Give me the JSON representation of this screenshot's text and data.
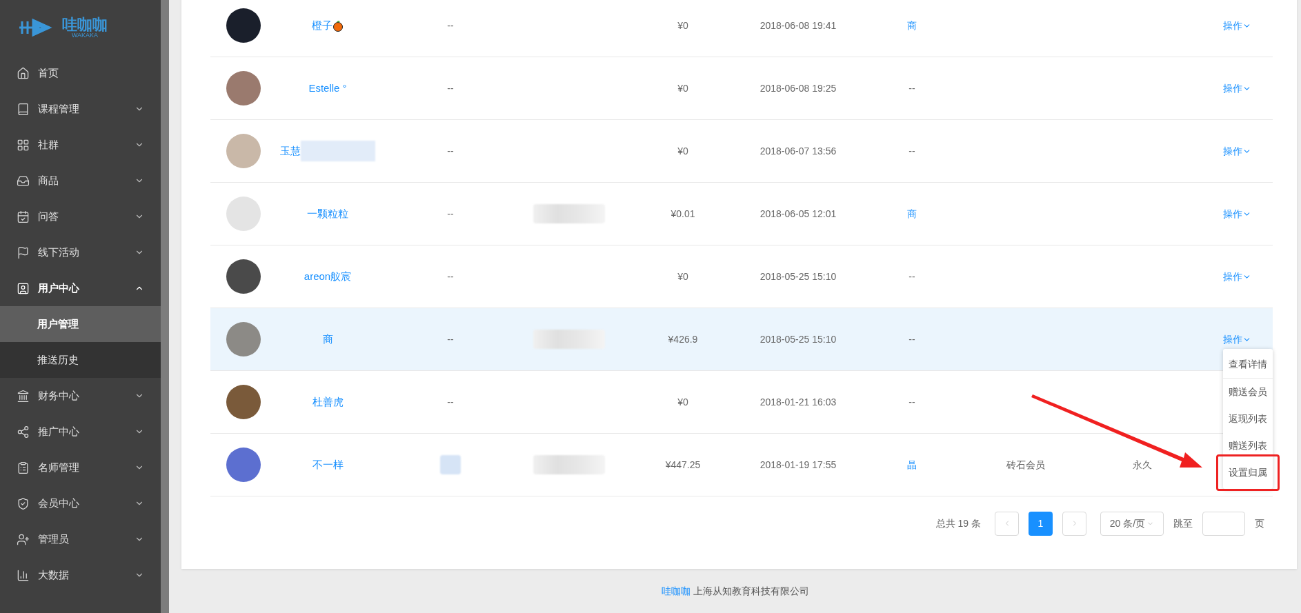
{
  "logo": {
    "text": "哇咖咖",
    "subtext": "WAKAKA"
  },
  "sidebar": {
    "items": [
      {
        "label": "首页",
        "expanded": false,
        "has_children": false
      },
      {
        "label": "课程管理",
        "expanded": false,
        "has_children": true
      },
      {
        "label": "社群",
        "expanded": false,
        "has_children": true
      },
      {
        "label": "商品",
        "expanded": false,
        "has_children": true
      },
      {
        "label": "问答",
        "expanded": false,
        "has_children": true
      },
      {
        "label": "线下活动",
        "expanded": false,
        "has_children": true
      },
      {
        "label": "用户中心",
        "expanded": true,
        "has_children": true,
        "children": [
          {
            "label": "用户管理",
            "selected": true
          },
          {
            "label": "推送历史",
            "selected": false
          }
        ]
      },
      {
        "label": "财务中心",
        "expanded": false,
        "has_children": true
      },
      {
        "label": "推广中心",
        "expanded": false,
        "has_children": true
      },
      {
        "label": "名师管理",
        "expanded": false,
        "has_children": true
      },
      {
        "label": "会员中心",
        "expanded": false,
        "has_children": true
      },
      {
        "label": "管理员",
        "expanded": false,
        "has_children": true
      },
      {
        "label": "大数据",
        "expanded": false,
        "has_children": true
      }
    ]
  },
  "table": {
    "rows": [
      {
        "name": "橙子",
        "has_icon": true,
        "name_blurred": false,
        "column_3": {
          "kind": "text",
          "text": "--"
        },
        "column_4": {
          "kind": "empty"
        },
        "price": "¥0",
        "date": "2018-06-08 19:41",
        "column_7": {
          "kind": "link",
          "text": "商"
        },
        "action": "操作",
        "selected": false
      },
      {
        "name": "Estelle °",
        "has_icon": false,
        "name_blurred": false,
        "column_3": {
          "kind": "text",
          "text": "--"
        },
        "column_4": {
          "kind": "empty"
        },
        "price": "¥0",
        "date": "2018-06-08 19:25",
        "column_7": {
          "kind": "text",
          "text": "--"
        },
        "action": "操作",
        "selected": false
      },
      {
        "name": "玉慧",
        "has_icon": false,
        "name_blurred": true,
        "column_3": {
          "kind": "text",
          "text": "--"
        },
        "column_4": {
          "kind": "empty"
        },
        "price": "¥0",
        "date": "2018-06-07 13:56",
        "column_7": {
          "kind": "text",
          "text": "--"
        },
        "action": "操作",
        "selected": false
      },
      {
        "name": "一颗粒粒",
        "has_icon": false,
        "name_blurred": false,
        "column_3": {
          "kind": "text",
          "text": "--"
        },
        "column_4": {
          "kind": "blurred"
        },
        "price": "¥0.01",
        "date": "2018-06-05 12:01",
        "column_7": {
          "kind": "link",
          "text": "商"
        },
        "action": "操作",
        "selected": false
      },
      {
        "name": "areon舣宸",
        "has_icon": false,
        "name_blurred": false,
        "column_3": {
          "kind": "text",
          "text": "--"
        },
        "column_4": {
          "kind": "empty"
        },
        "price": "¥0",
        "date": "2018-05-25 15:10",
        "column_7": {
          "kind": "text",
          "text": "--"
        },
        "action": "操作",
        "selected": false
      },
      {
        "name": "商",
        "has_icon": false,
        "name_blurred": false,
        "column_3": {
          "kind": "text",
          "text": "--"
        },
        "column_4": {
          "kind": "blurred"
        },
        "price": "¥426.9",
        "date": "2018-05-25 15:10",
        "column_7": {
          "kind": "text",
          "text": "--"
        },
        "action": "操作",
        "selected": true,
        "menu": {
          "items": [
            {
              "label": "查看详情",
              "highlighted": false
            },
            {
              "label": "赠送会员",
              "highlighted": false
            },
            {
              "label": "返现列表",
              "highlighted": false
            },
            {
              "label": "赠送列表",
              "highlighted": false
            },
            {
              "label": "设置归属",
              "highlighted": true
            }
          ]
        }
      },
      {
        "name": "杜善虎",
        "has_icon": false,
        "name_blurred": false,
        "column_3": {
          "kind": "text",
          "text": "--"
        },
        "column_4": {
          "kind": "empty"
        },
        "price": "¥0",
        "date": "2018-01-21 16:03",
        "column_7": {
          "kind": "text",
          "text": "--"
        },
        "selected": false
      },
      {
        "name": "不一样",
        "has_icon": false,
        "name_blurred": false,
        "column_3": {
          "kind": "blurred"
        },
        "column_4": {
          "kind": "blurred"
        },
        "price": "¥447.25",
        "date": "2018-01-19 17:55",
        "column_7": {
          "kind": "link",
          "text": "晶"
        },
        "membership": "砖石会员",
        "duration": "永久",
        "selected": false
      }
    ]
  },
  "pagination": {
    "total": "总共 19 条",
    "pages": [
      {
        "label": "1",
        "selected": true
      }
    ],
    "page_size": "20 条/页",
    "jump_label": "跳至",
    "page_unit": "页"
  },
  "footer": {
    "brand": "哇咖咖",
    "company": "上海从知教育科技有限公司"
  }
}
